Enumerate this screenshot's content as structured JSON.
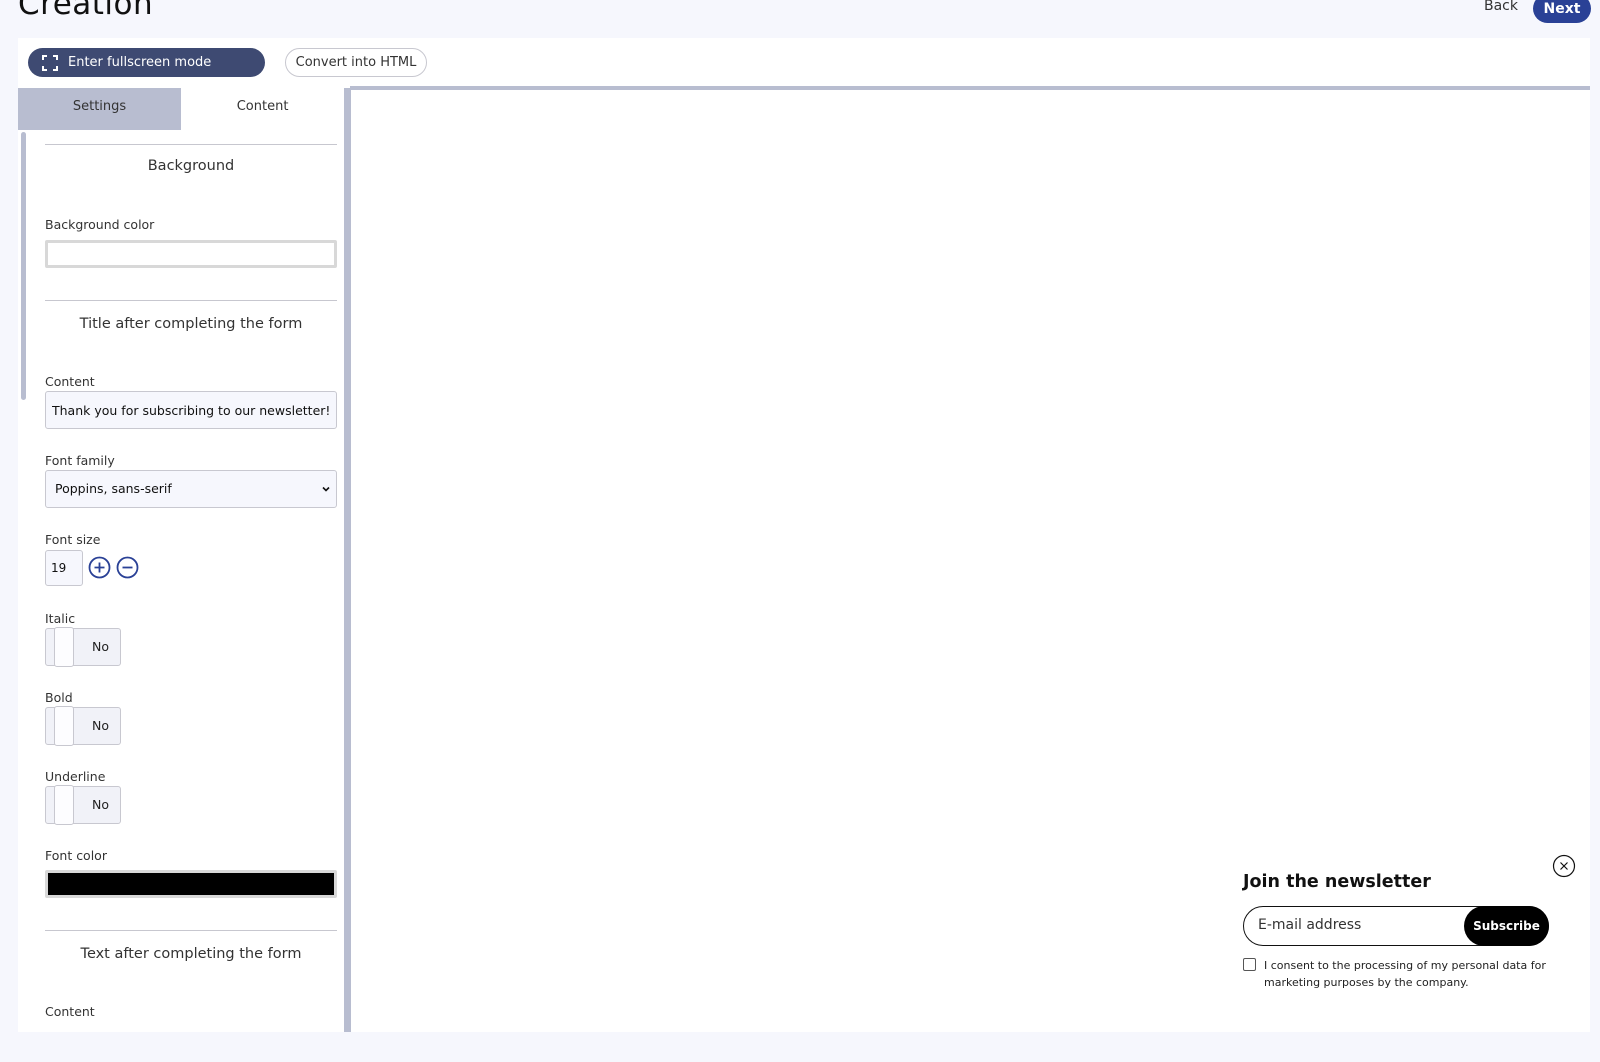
{
  "header": {
    "title": "Creation",
    "back_label": "Back",
    "next_label": "Next"
  },
  "toolbar": {
    "fullscreen_label": "Enter fullscreen mode",
    "convert_label": "Convert into HTML"
  },
  "tabs": [
    {
      "label": "Settings",
      "active": false
    },
    {
      "label": "Content",
      "active": true
    }
  ],
  "panel": {
    "background": {
      "title": "Background",
      "color_label": "Background color",
      "color_value": "#ffffff"
    },
    "title_after": {
      "title": "Title after completing the form",
      "content_label": "Content",
      "content_value": "Thank you for subscribing to our newsletter!",
      "font_family_label": "Font family",
      "font_family_value": "Poppins, sans-serif",
      "font_size_label": "Font size",
      "font_size_value": "19",
      "italic_label": "Italic",
      "italic_value": "No",
      "bold_label": "Bold",
      "bold_value": "No",
      "underline_label": "Underline",
      "underline_value": "No",
      "font_color_label": "Font color",
      "font_color_value": "#000000"
    },
    "text_after": {
      "title": "Text after completing the form",
      "content_label": "Content"
    }
  },
  "newsletter": {
    "title": "Join the newsletter",
    "email_placeholder": "E-mail address",
    "subscribe_label": "Subscribe",
    "consent_text": "I consent to the processing of my personal data for marketing purposes by the company."
  },
  "colors": {
    "accent": "#2a4196",
    "fullscreen_button": "#3e4a72",
    "tab_inactive": "#b8bdd0"
  }
}
